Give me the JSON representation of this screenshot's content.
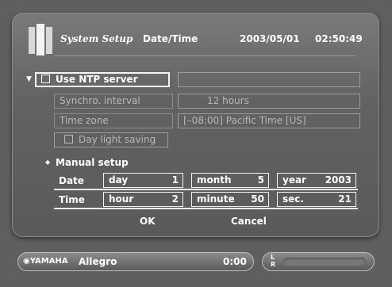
{
  "header": {
    "app_title": "System Setup",
    "section": "Date/Time",
    "date": "2003/05/01",
    "time": "02:50:49"
  },
  "ntp": {
    "use_ntp_label": "Use NTP server",
    "ntp_server_value": "",
    "sync_interval_label": "Synchro. interval",
    "sync_interval_value": "12  hours",
    "timezone_label": "Time zone",
    "timezone_value": "[–08:00] Pacific Time [US]",
    "daylight_label": "Day light saving"
  },
  "manual": {
    "title": "Manual setup",
    "date_label": "Date",
    "time_label": "Time",
    "day_label": "day",
    "day_value": "1",
    "month_label": "month",
    "month_value": "5",
    "year_label": "year",
    "year_value": "2003",
    "hour_label": "hour",
    "hour_value": "2",
    "minute_label": "minute",
    "minute_value": "50",
    "sec_label": "sec.",
    "sec_value": "21"
  },
  "buttons": {
    "ok": "OK",
    "cancel": "Cancel"
  },
  "status": {
    "brand": "YAMAHA",
    "album": "Allegro",
    "elapsed": "0:00",
    "channel_l": "L",
    "channel_r": "R"
  }
}
